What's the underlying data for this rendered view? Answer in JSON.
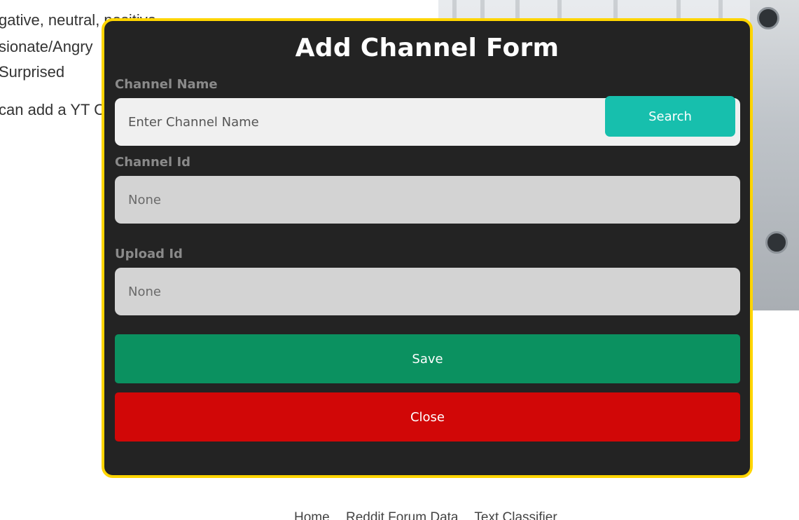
{
  "background": {
    "lines": [
      "gative, neutral, positive",
      "sionate/Angry",
      "Surprised",
      "can add a YT C"
    ],
    "footer_links": [
      "Home",
      "Reddit Forum Data",
      "Text Classifier"
    ]
  },
  "modal": {
    "title": "Add Channel Form",
    "channel_name": {
      "label": "Channel Name",
      "placeholder": "Enter Channel Name"
    },
    "search_label": "Search",
    "channel_id": {
      "label": "Channel Id",
      "value": "None"
    },
    "upload_id": {
      "label": "Upload Id",
      "value": "None"
    },
    "save_label": "Save",
    "close_label": "Close"
  },
  "colors": {
    "modal_border": "#ffd500",
    "modal_bg": "#232323",
    "search": "#17bfad",
    "save": "#0b9160",
    "close": "#d10707"
  }
}
